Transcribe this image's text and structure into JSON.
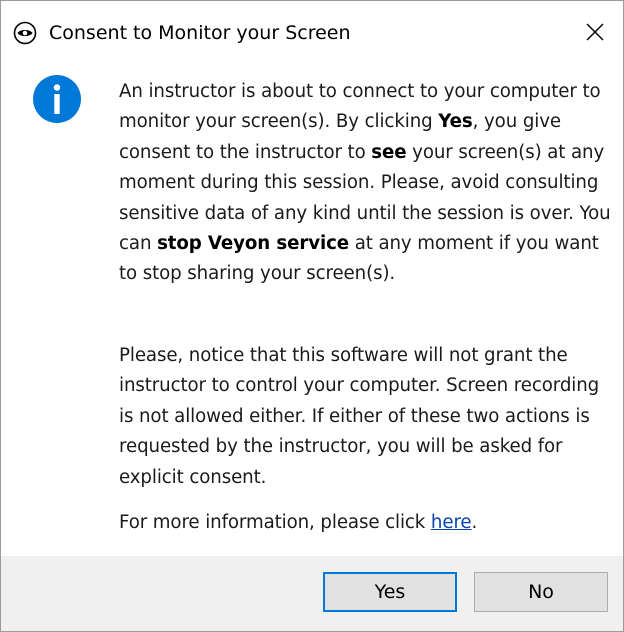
{
  "window": {
    "title": "Consent to Monitor your Screen",
    "icon": "eye-icon",
    "close_icon": "close-icon"
  },
  "message": {
    "icon": "info-icon",
    "accent_color": "#0078d7",
    "para1": {
      "t1": "An instructor is about to connect to your computer to monitor your screen(s). By clicking ",
      "b1": "Yes",
      "t2": ", you give consent to the instructor to ",
      "b2": "see",
      "t3": " your screen(s) at any moment during this session. Please, avoid consulting sensitive data of any kind until the session is over. You can ",
      "b3": "stop Veyon service",
      "t4": " at any moment if you want to stop sharing your screen(s)."
    },
    "para2": "Please, notice that this software will not grant the instructor to control your computer. Screen recording is not allowed either. If either of these two actions is requested by the instructor, you will be asked for explicit consent.",
    "para3": {
      "text": "For more information, please click ",
      "link": "here",
      "end": "."
    }
  },
  "buttons": {
    "yes": "Yes",
    "no": "No"
  }
}
